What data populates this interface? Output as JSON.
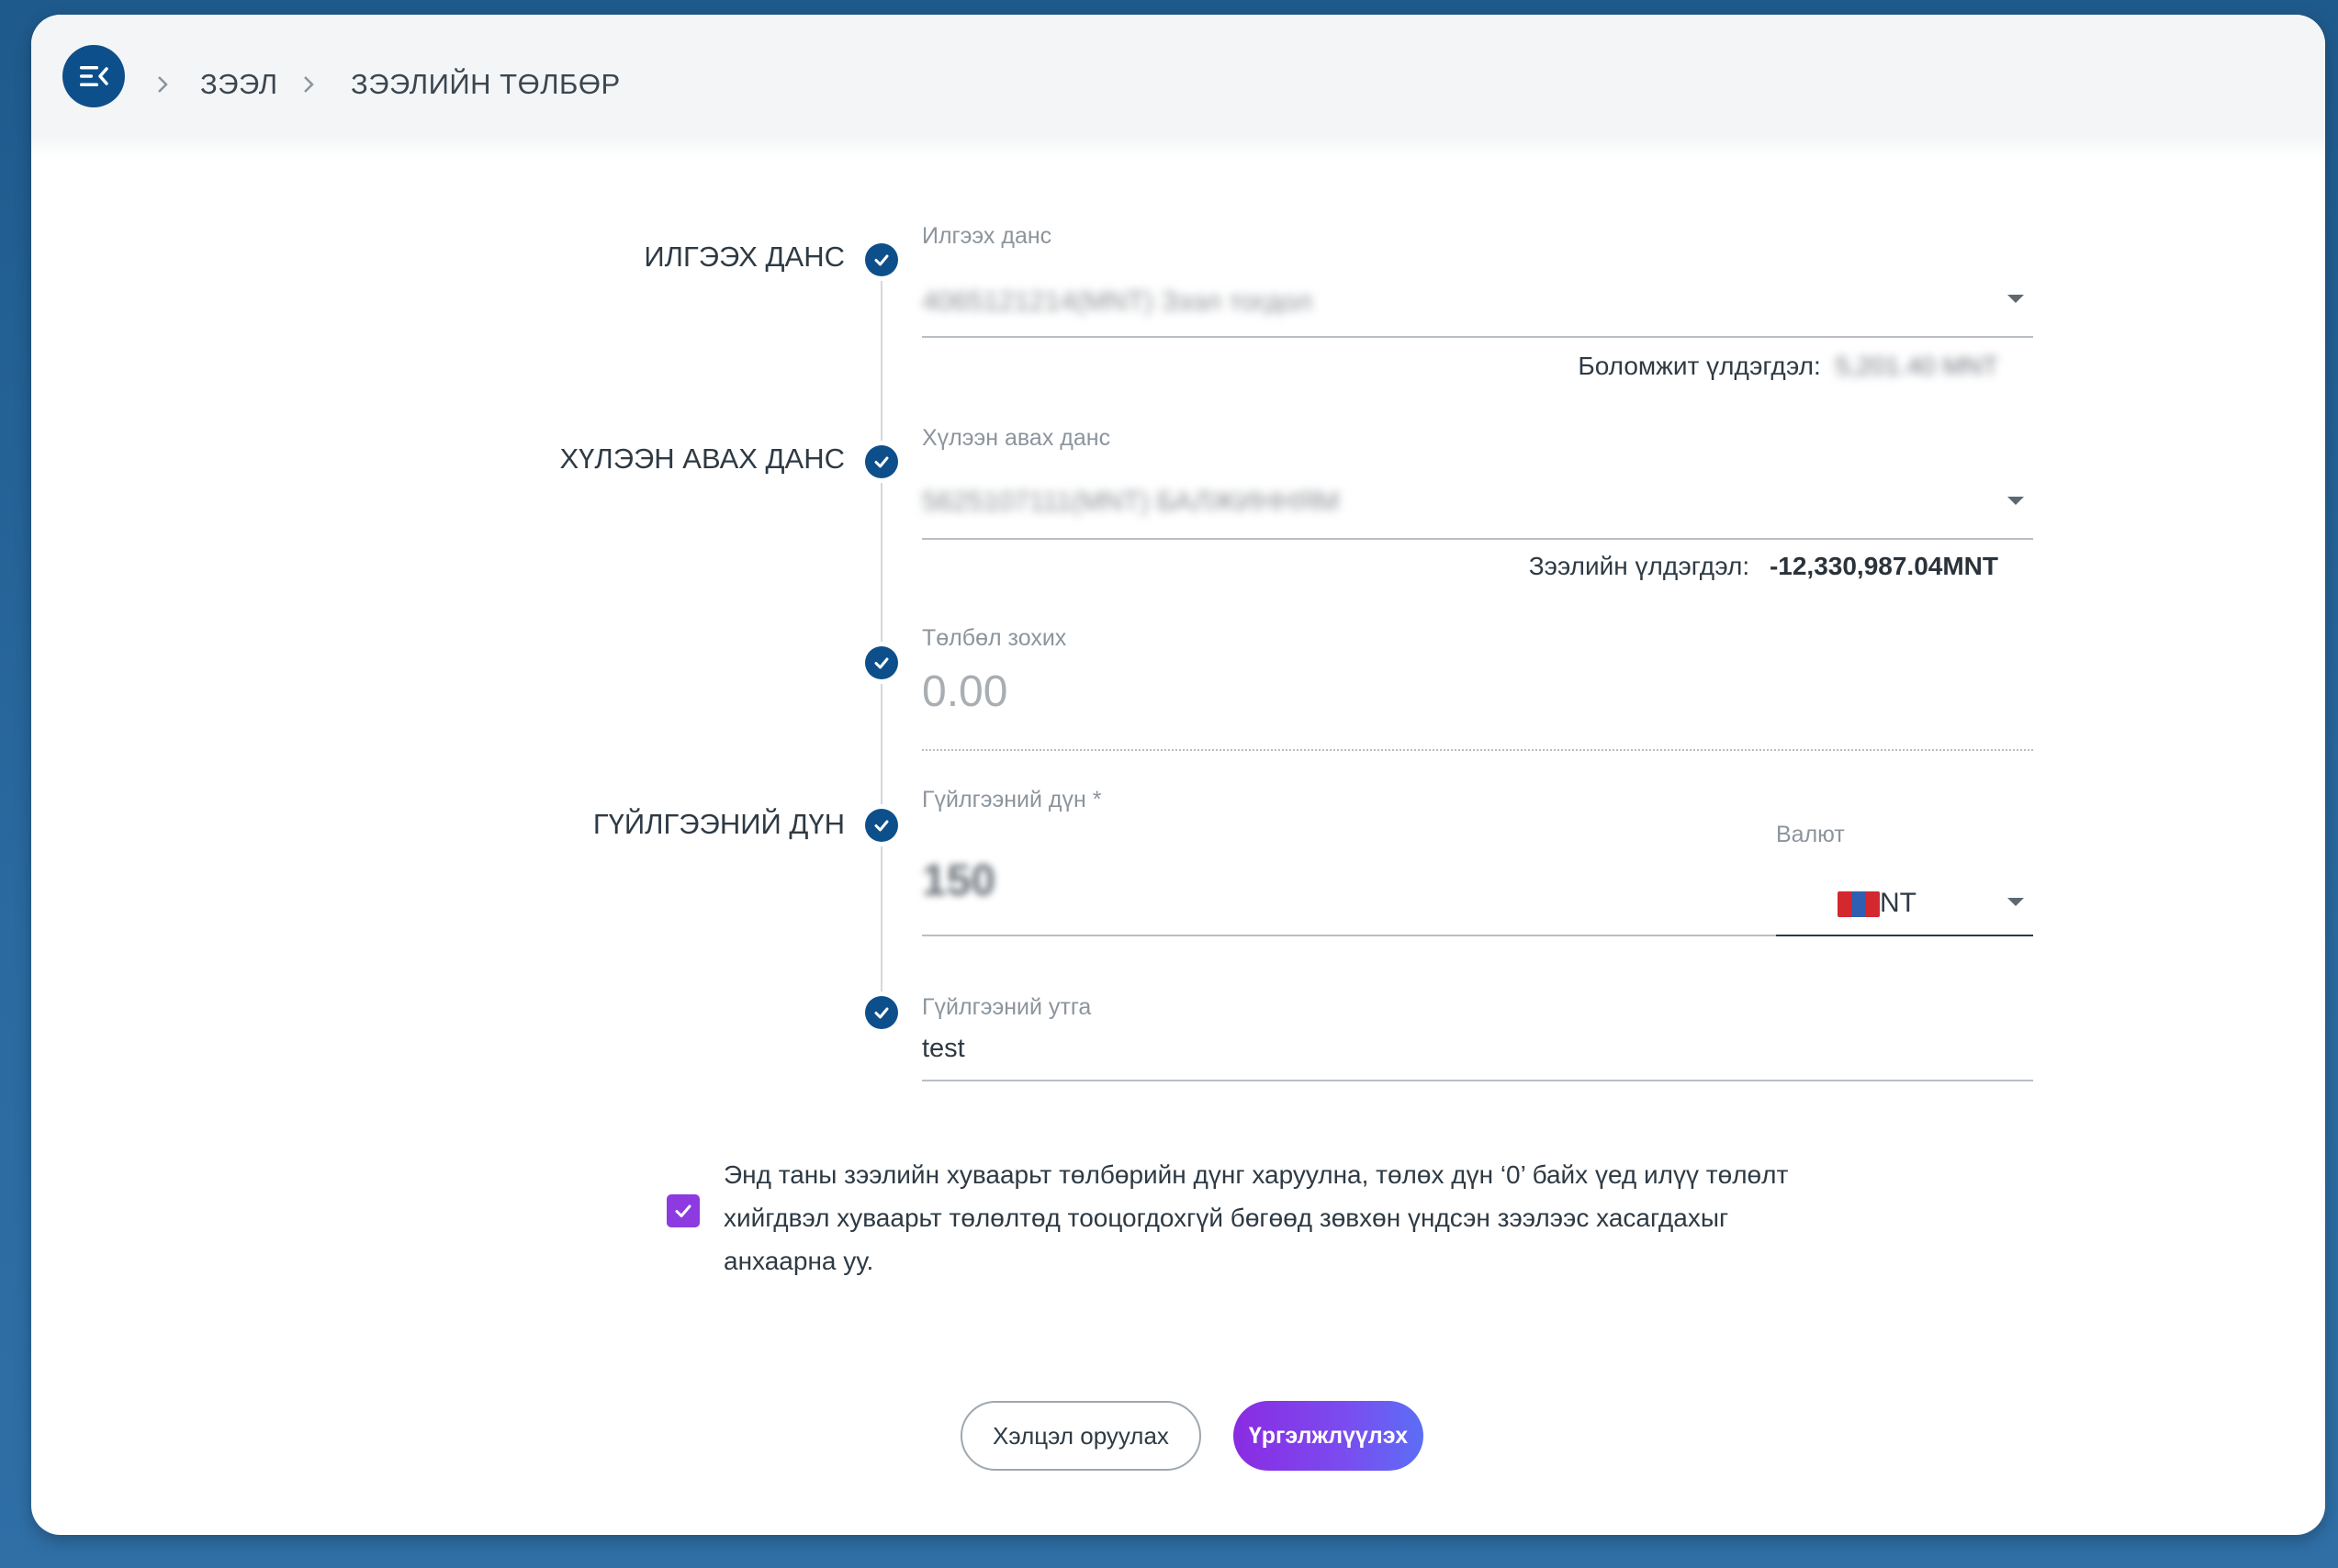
{
  "breadcrumb": {
    "items": [
      "ЗЭЭЛ",
      "ЗЭЭЛИЙН ТӨЛБӨР"
    ]
  },
  "form": {
    "sections": {
      "from_account": "ИЛГЭЭХ ДАНС",
      "to_account": "ХҮЛЭЭН АВАХ ДАНС",
      "amount": "ГҮЙЛГЭЭНИЙ ДҮН"
    },
    "from_account": {
      "label": "Илгээх данс",
      "value": "4065121214(MNT) Зээл тогдол",
      "balance_label": "Боломжит үлдэгдэл:",
      "balance_value": "5,201.40 MNT"
    },
    "to_account": {
      "label": "Хүлээн авах данс",
      "value": "5625107111(MNT) БАЛЖИННЯМ",
      "balance_label": "Зээлийн үлдэгдэл:",
      "balance_value": "-12,330,987.04MNT"
    },
    "payable": {
      "label": "Төлбөл зохих",
      "placeholder": "0.00"
    },
    "amount": {
      "label": "Гүйлгээний дүн *",
      "value": "150",
      "currency_label": "Валют",
      "currency_value": "MNT"
    },
    "description": {
      "label": "Гүйлгээний утга",
      "value": "test"
    }
  },
  "notice": {
    "checked": true,
    "text": "Энд таны зээлийн хуваарьт төлбөрийн дүнг харуулна, төлөх дүн ‘0’ байх үед илүү төлөлт хийгдвэл хуваарьт төлөлтөд тооцогдохгүй бөгөөд зөвхөн үндсэн зээлээс хасагдахыг анхаарна уу."
  },
  "actions": {
    "secondary": "Хэлцэл оруулах",
    "primary": "Үргэлжлүүлэх"
  },
  "colors": {
    "brand_navy": "#0d4f8b",
    "primary_gradient_start": "#8a2be2",
    "primary_gradient_end": "#5b6ef5",
    "checkbox": "#8d3be0"
  },
  "icons": {
    "menu": "menu-collapse-icon",
    "breadcrumb_separator": "chevron-right-icon",
    "timeline_step": "check-circle-icon",
    "dropdown": "caret-down-icon",
    "currency_flag": "mongolia-flag-icon"
  }
}
